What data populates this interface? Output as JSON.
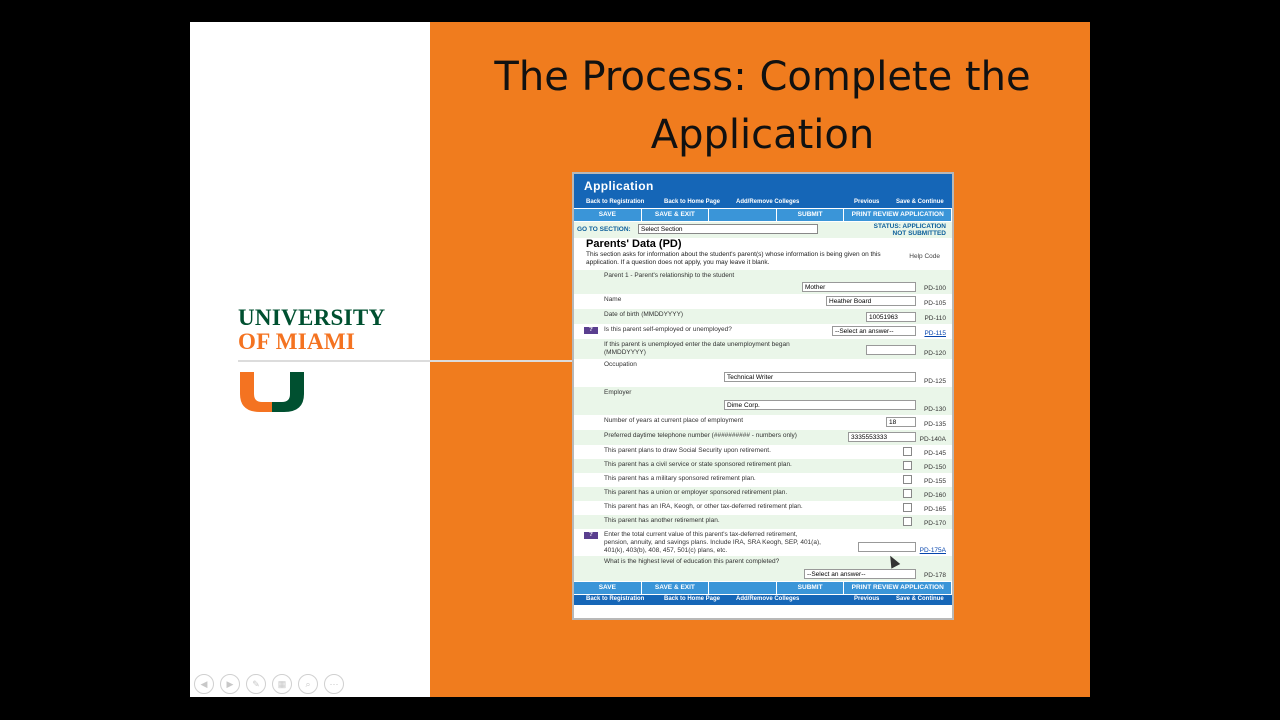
{
  "slide": {
    "title": "The Process: Complete the Application",
    "university": {
      "line1": "UNIVERSITY",
      "line2": "OF MIAMI"
    }
  },
  "app": {
    "header": "Application",
    "top_links": [
      "Back to Registration",
      "Back to Home Page",
      "Add/Remove Colleges",
      "Previous",
      "Save & Continue"
    ],
    "buttons": [
      "SAVE",
      "SAVE & EXIT",
      "",
      "SUBMIT",
      "PRINT REVIEW APPLICATION"
    ],
    "goto_label": "GO TO SECTION:",
    "goto_value": "Select Section",
    "status_line1": "STATUS: APPLICATION",
    "status_line2": "NOT SUBMITTED",
    "section_title": "Parents' Data (PD)",
    "section_desc": "This section asks for information about the student's parent(s) whose information is being given on this application. If a question does not apply, you may leave it blank.",
    "help_code": "Help Code",
    "fields": [
      {
        "label": "Parent 1 - Parent's relationship to the student",
        "value": "Mother",
        "code": "PD-100"
      },
      {
        "label": "Name",
        "value": "Heather Board",
        "code": "PD-105"
      },
      {
        "label": "Date of birth (MMDDYYYY)",
        "value": "10051963",
        "code": "PD-110"
      },
      {
        "label": "Is this parent self-employed or unemployed?",
        "value": "--Select an answer--",
        "code": "PD-115"
      },
      {
        "label": "If this parent is unemployed enter the date unemployment began (MMDDYYYY)",
        "value": "",
        "code": "PD-120"
      },
      {
        "label": "Occupation",
        "value": "Technical Writer",
        "code": "PD-125"
      },
      {
        "label": "Employer",
        "value": "Dime Corp.",
        "code": "PD-130"
      },
      {
        "label": "Number of years at current place of employment",
        "value": "18",
        "code": "PD-135"
      },
      {
        "label": "Preferred daytime telephone number (########## - numbers only)",
        "value": "3335553333",
        "code": "PD-140A"
      },
      {
        "label": "This parent plans to draw Social Security upon retirement.",
        "value": "",
        "code": "PD-145"
      },
      {
        "label": "This parent has a civil service or state sponsored retirement plan.",
        "value": "",
        "code": "PD-150"
      },
      {
        "label": "This parent has a military sponsored retirement plan.",
        "value": "",
        "code": "PD-155"
      },
      {
        "label": "This parent has a union or employer sponsored retirement plan.",
        "value": "",
        "code": "PD-160"
      },
      {
        "label": "This parent has an IRA, Keogh, or other tax-deferred retirement plan.",
        "value": "",
        "code": "PD-165"
      },
      {
        "label": "This parent has another retirement plan.",
        "value": "",
        "code": "PD-170"
      },
      {
        "label": "Enter the total current value of this parent's tax-deferred retirement, pension, annuity, and savings plans. Include IRA, SRA Keogh, SEP, 401(a), 401(k), 403(b), 408, 457, 501(c) plans, etc.",
        "value": "",
        "code": "PD-175A"
      },
      {
        "label": "What is the highest level of education this parent completed?",
        "value": "--Select an answer--",
        "code": "PD-178"
      }
    ]
  }
}
